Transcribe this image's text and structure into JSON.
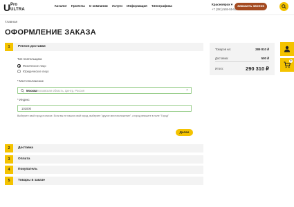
{
  "header": {
    "logo": {
      "u": "U",
      "pro": "Pro",
      "ultra": "ULTRA"
    },
    "nav": [
      "Каталог",
      "Проекты",
      "О компании",
      "Услуги",
      "Информация",
      "Типографика"
    ],
    "city": "Красноярск ▾",
    "phone": "+7 (391) 555-55-55",
    "call_button": "Заказать звонок",
    "search_icon": "search-icon"
  },
  "breadcrumb": "Главная",
  "page_title": "ОФОРМЛЕНИЕ ЗАКАЗА",
  "steps": [
    {
      "num": "1",
      "label": "Регион доставки"
    },
    {
      "num": "2",
      "label": "Доставка"
    },
    {
      "num": "3",
      "label": "Оплата"
    },
    {
      "num": "4",
      "label": "Покупатель"
    },
    {
      "num": "5",
      "label": "Товары в заказе"
    }
  ],
  "region_form": {
    "payer_type_label": "Тип плательщика",
    "payer_types": [
      {
        "label": "Физическое лицо",
        "checked": true
      },
      {
        "label": "Юридическое лицо",
        "checked": false
      }
    ],
    "location_label": "* Местоположение",
    "location_city": "Москва",
    "location_region": "Московская область, Центр, Россия",
    "index_label": "* Индекс",
    "index_value": "101000",
    "hint": "Выберите свой город в списке. Если вы не нашли свой город, выберите \"другое местоположение\", а город впишите в поле \"Город\"",
    "next_button": "Далее"
  },
  "summary": {
    "goods_label": "Товаров на:",
    "goods_value": "289 810 ₽",
    "delivery_label": "Доставка:",
    "delivery_value": "500 ₽",
    "total_label": "Итого:",
    "total_value": "290 310 ₽"
  },
  "side_buttons": {
    "account_icon": "user-icon",
    "cart_icon": "cart-icon",
    "cart_count": "0"
  },
  "colors": {
    "accent": "#f4c300",
    "call_button": "#a44b21",
    "field_border": "#9bcf8e",
    "panel": "#f3f3f3"
  }
}
